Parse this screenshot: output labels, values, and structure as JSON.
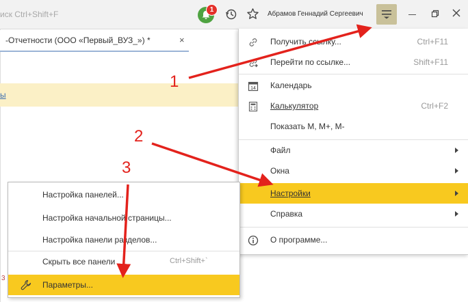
{
  "search": {
    "placeholder_text": "иск Ctrl+Shift+F"
  },
  "header": {
    "notifications_count": "1",
    "user_name": "Абрамов Геннадий Сергеевич"
  },
  "tab": {
    "label": "-Отчетности (ООО «Первый_ВУЗ_»)",
    "modified_mark": "*",
    "close": "×"
  },
  "background": {
    "link_fragment": "ы",
    "bottom_hint": "3"
  },
  "main_menu": {
    "items": [
      {
        "label": "Получить ссылку...",
        "shortcut": "Ctrl+F11",
        "icon": "link-icon"
      },
      {
        "label": "Перейти по ссылке...",
        "shortcut": "Shift+F11",
        "icon": "goto-link-icon"
      },
      {
        "label": "Календарь",
        "shortcut": "",
        "icon": "calendar-icon",
        "icon_text": "14"
      },
      {
        "label": "Калькулятор",
        "shortcut": "Ctrl+F2",
        "icon": "calculator-icon"
      },
      {
        "label": "Показать M, M+, M-",
        "shortcut": ""
      },
      {
        "label": "Файл",
        "has_submenu": true
      },
      {
        "label": "Окна",
        "has_submenu": true
      },
      {
        "label": "Настройки",
        "has_submenu": true,
        "highlighted": true
      },
      {
        "label": "Справка",
        "has_submenu": true
      },
      {
        "label": "О программе...",
        "icon": "info-icon"
      }
    ]
  },
  "settings_submenu": {
    "items": [
      {
        "label": "Настройка панелей..."
      },
      {
        "label": "Настройка начальной страницы..."
      },
      {
        "label": "Настройка панели разделов..."
      },
      {
        "label": "Скрыть все панели",
        "shortcut": "Ctrl+Shift+`"
      },
      {
        "label": "Параметры...",
        "highlighted": true,
        "icon": "wrench-icon"
      }
    ]
  },
  "annotations": {
    "step1": "1",
    "step2": "2",
    "step3": "3"
  },
  "colors": {
    "highlight": "#f8c91f",
    "annotation_red": "#e3221c",
    "notification_green": "#4fa341",
    "badge_red": "#e4312a"
  }
}
